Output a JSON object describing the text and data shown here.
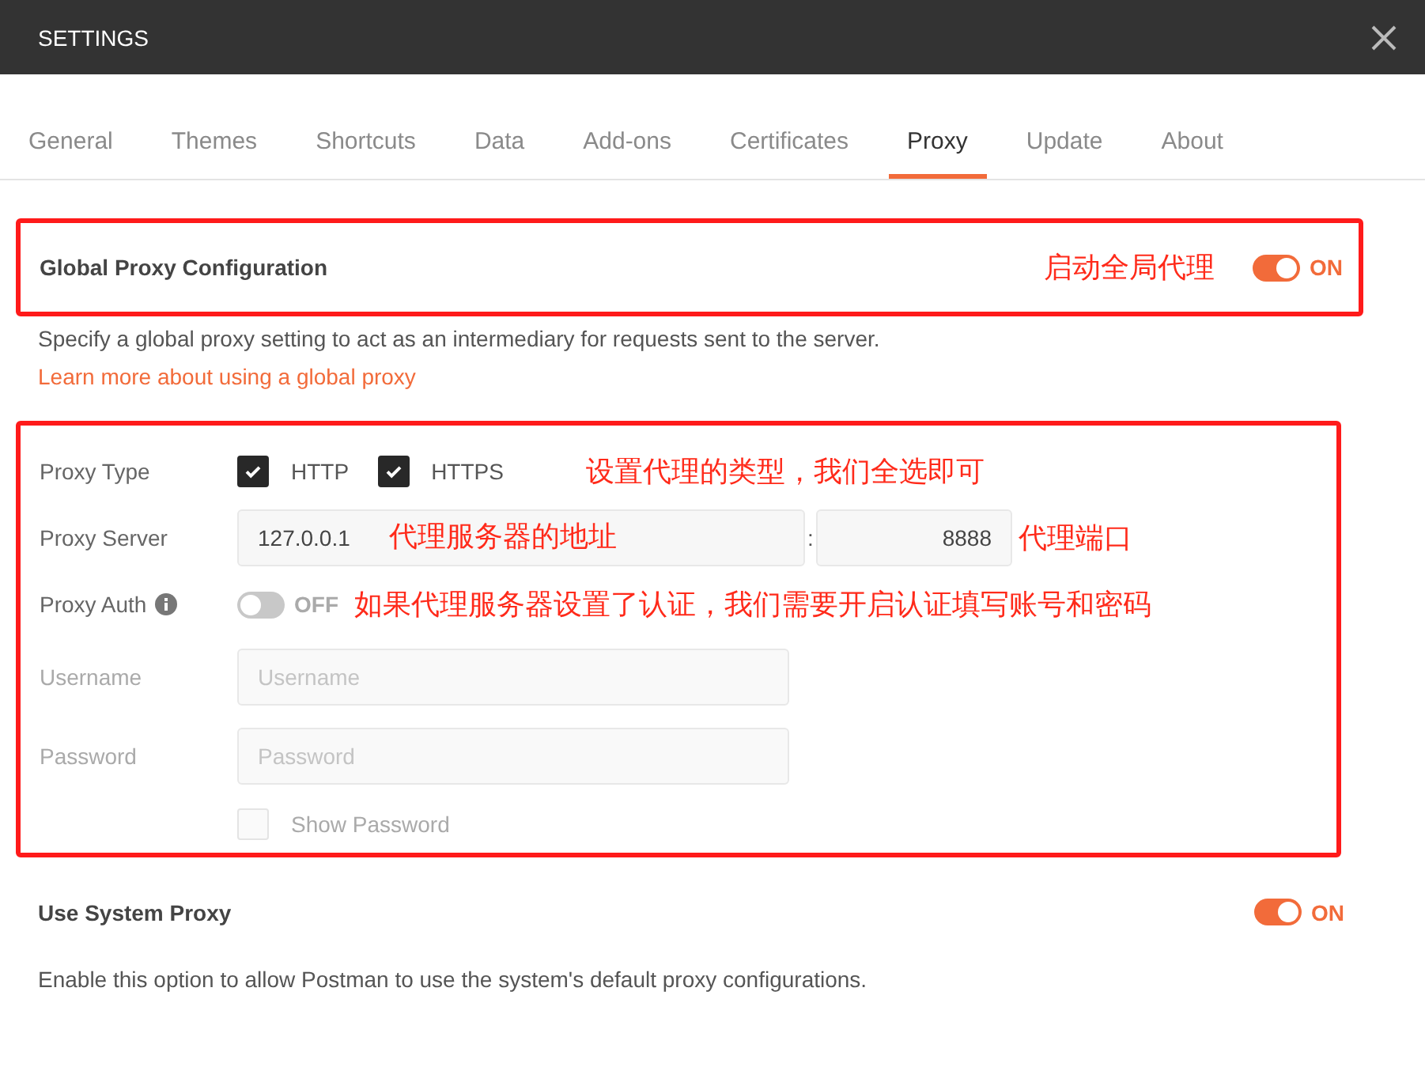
{
  "window": {
    "title": "SETTINGS"
  },
  "tabs": [
    {
      "label": "General",
      "selected": false
    },
    {
      "label": "Themes",
      "selected": false
    },
    {
      "label": "Shortcuts",
      "selected": false
    },
    {
      "label": "Data",
      "selected": false
    },
    {
      "label": "Add-ons",
      "selected": false
    },
    {
      "label": "Certificates",
      "selected": false
    },
    {
      "label": "Proxy",
      "selected": true
    },
    {
      "label": "Update",
      "selected": false
    },
    {
      "label": "About",
      "selected": false
    }
  ],
  "global_proxy": {
    "title": "Global Proxy Configuration",
    "annotation": "启动全局代理",
    "on": true,
    "state_label": "ON",
    "description": "Specify a global proxy setting to act as an intermediary for requests sent to the server.",
    "link": "Learn more about using a global proxy"
  },
  "proxy_form": {
    "type_label": "Proxy Type",
    "protocols": [
      {
        "label": "HTTP",
        "checked": true
      },
      {
        "label": "HTTPS",
        "checked": true
      }
    ],
    "type_annotation": "设置代理的类型，我们全选即可",
    "server_label": "Proxy Server",
    "host_value": "127.0.0.1",
    "host_annotation": "代理服务器的地址",
    "separator": ":",
    "port_value": "8888",
    "port_annotation": "代理端口",
    "auth_label": "Proxy Auth",
    "auth_on": false,
    "auth_state_label": "OFF",
    "auth_annotation": "如果代理服务器设置了认证，我们需要开启认证填写账号和密码",
    "username": {
      "label": "Username",
      "placeholder": "Username",
      "disabled": true
    },
    "password": {
      "label": "Password",
      "placeholder": "Password",
      "disabled": true
    },
    "show_password": {
      "label": "Show Password",
      "checked": false,
      "disabled": true
    }
  },
  "system_proxy": {
    "title": "Use System Proxy",
    "on": true,
    "state_label": "ON",
    "description": "Enable this option to allow Postman to use the system's default proxy configurations."
  }
}
